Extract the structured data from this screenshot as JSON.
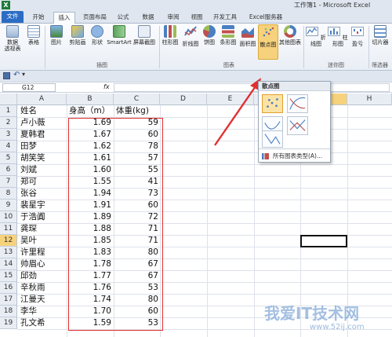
{
  "window": {
    "title": "工作簿1 - Microsoft Excel"
  },
  "tabs": [
    {
      "label": "文件"
    },
    {
      "label": "开始"
    },
    {
      "label": "插入"
    },
    {
      "label": "页面布局"
    },
    {
      "label": "公式"
    },
    {
      "label": "数据"
    },
    {
      "label": "审阅"
    },
    {
      "label": "视图"
    },
    {
      "label": "开发工具"
    },
    {
      "label": "Excel服务器"
    }
  ],
  "ribbon": {
    "buttons": {
      "pivot": "数据\n透视表",
      "table": "表格",
      "picture": "图片",
      "clipart": "剪贴画",
      "shapes": "形状",
      "smartart": "SmartArt",
      "screenshot": "屏幕截图",
      "column": "柱形图",
      "line": "折线图",
      "pie": "饼图",
      "bar": "条形图",
      "area": "面积图",
      "scatter": "散点图",
      "other": "其他图表",
      "spark_line": "折线图",
      "spark_column": "柱形图",
      "spark_winloss": "盈亏",
      "slicer": "切片器"
    },
    "groups": {
      "illustrations": "插图",
      "charts": "图表",
      "sparklines": "迷你图",
      "filter": "筛选器"
    }
  },
  "formula_bar": {
    "name_box": "G12",
    "fx": "fx"
  },
  "columns": [
    "A",
    "B",
    "C",
    "D",
    "E",
    "F",
    "G",
    "H"
  ],
  "rows": [
    {
      "n": "1",
      "name": "姓名",
      "height": "身高（m）",
      "weight": "体重(kg)"
    },
    {
      "n": "2",
      "name": "卢小薇",
      "height": "1.69",
      "weight": "59"
    },
    {
      "n": "3",
      "name": "夏韩君",
      "height": "1.67",
      "weight": "60"
    },
    {
      "n": "4",
      "name": "田梦",
      "height": "1.62",
      "weight": "78"
    },
    {
      "n": "5",
      "name": "胡笑笑",
      "height": "1.61",
      "weight": "57"
    },
    {
      "n": "6",
      "name": "刘斌",
      "height": "1.60",
      "weight": "55"
    },
    {
      "n": "7",
      "name": "郑可",
      "height": "1.55",
      "weight": "41"
    },
    {
      "n": "8",
      "name": "张谷",
      "height": "1.94",
      "weight": "73"
    },
    {
      "n": "9",
      "name": "裴星宇",
      "height": "1.91",
      "weight": "60"
    },
    {
      "n": "10",
      "name": "于浩阗",
      "height": "1.89",
      "weight": "72"
    },
    {
      "n": "11",
      "name": "龚琛",
      "height": "1.88",
      "weight": "71"
    },
    {
      "n": "12",
      "name": "吴叶",
      "height": "1.85",
      "weight": "71"
    },
    {
      "n": "13",
      "name": "许里程",
      "height": "1.83",
      "weight": "80"
    },
    {
      "n": "14",
      "name": "帅眉心",
      "height": "1.78",
      "weight": "67"
    },
    {
      "n": "15",
      "name": "邱劲",
      "height": "1.77",
      "weight": "67"
    },
    {
      "n": "16",
      "name": "辛秋雨",
      "height": "1.76",
      "weight": "53"
    },
    {
      "n": "17",
      "name": "江曼天",
      "height": "1.74",
      "weight": "80"
    },
    {
      "n": "18",
      "name": "李华",
      "height": "1.70",
      "weight": "60"
    },
    {
      "n": "19",
      "name": "孔文希",
      "height": "1.59",
      "weight": "53"
    }
  ],
  "dropdown": {
    "header": "散点图",
    "footer": "所有图表类型(A)..."
  },
  "watermark": {
    "text": "我爱IT技术网",
    "url": "www.52ij.com"
  },
  "colors": {
    "file_tab": "#2b6cc4",
    "annotation": "#e03030",
    "selection": "#f7d27c"
  }
}
